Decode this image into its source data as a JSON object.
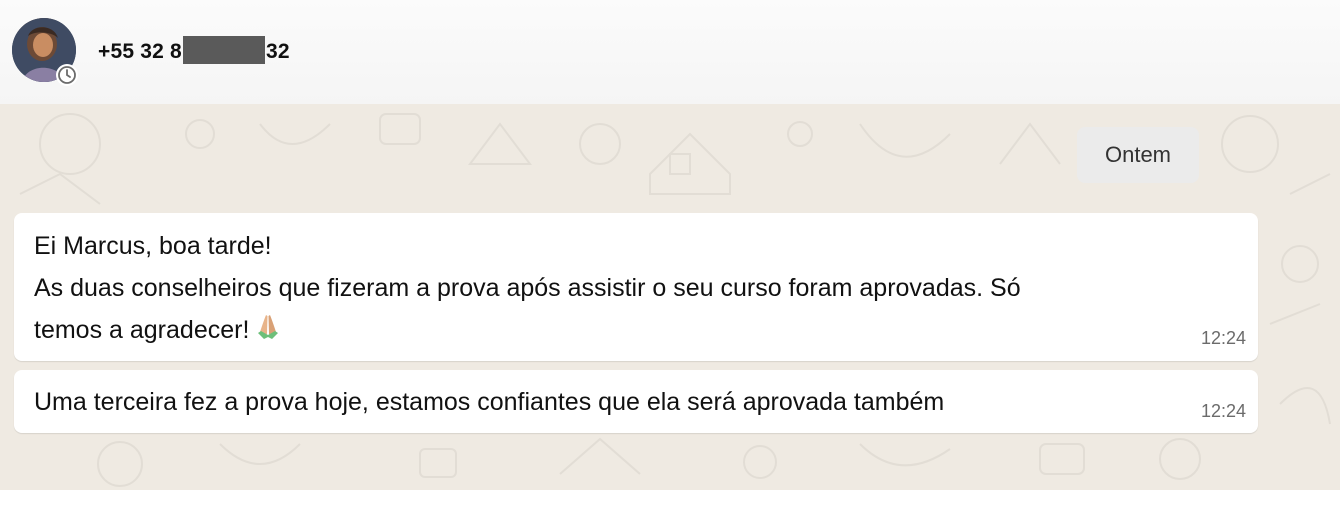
{
  "header": {
    "contact_prefix": "+55 32 8",
    "contact_suffix": "32",
    "avatar_icon": "avatar",
    "status_icon": "status-clock-icon"
  },
  "chat": {
    "date_separator": "Ontem",
    "messages": [
      {
        "lines": [
          "Ei Marcus, boa tarde!",
          "As duas conselheiros que fizeram a prova após assistir o seu curso foram aprovadas. Só",
          "temos a agradecer!"
        ],
        "emoji": "folded-hands-icon",
        "time": "12:24"
      },
      {
        "lines": [
          "Uma terceira fez a prova hoje,  estamos confiantes que ela será aprovada também"
        ],
        "time": "12:24"
      }
    ]
  },
  "colors": {
    "header_bg": "#f7f7f7",
    "chat_bg": "#efeae2",
    "bubble_bg": "#ffffff",
    "date_chip_bg": "#ebebeb",
    "redaction": "#5a5a5a"
  }
}
